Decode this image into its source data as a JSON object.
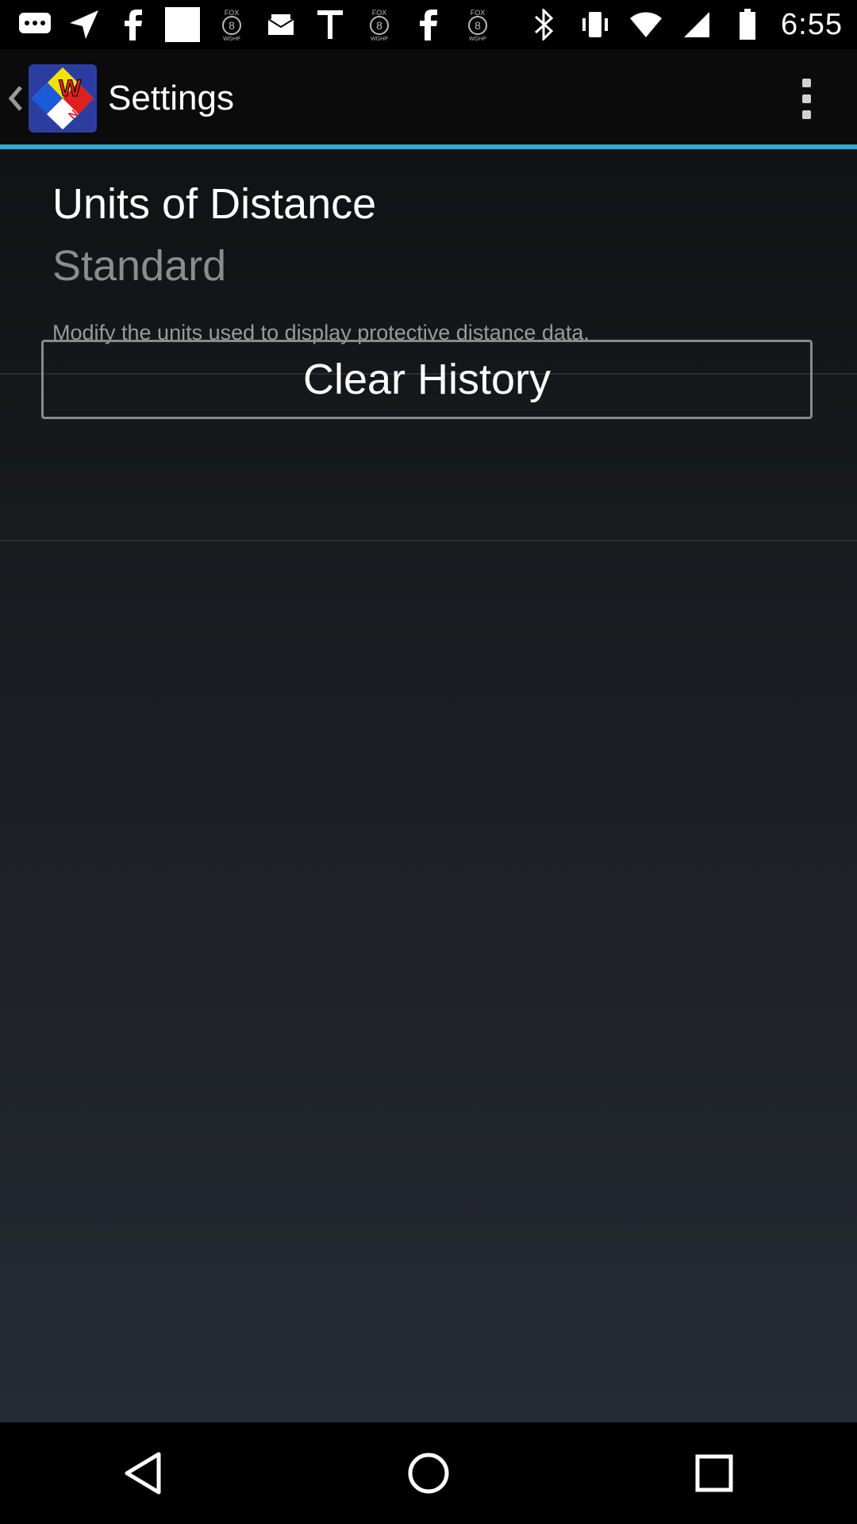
{
  "status_bar": {
    "left_icons": [
      "chat-icon",
      "navigation-icon",
      "facebook-icon",
      "image-icon",
      "fox8-icon",
      "mail-icon",
      "text-t-icon",
      "fox8-icon",
      "facebook-icon",
      "fox8-icon"
    ],
    "fox_label_top": "FOX",
    "fox_label_num": "8",
    "fox_label_bottom": "WGHP",
    "right_icons": [
      "bluetooth-icon",
      "vibrate-icon",
      "wifi-icon",
      "signal-icon",
      "battery-icon"
    ],
    "time": "6:55"
  },
  "action_bar": {
    "title": "Settings",
    "logo_letter": "W",
    "logo_text": "NIH"
  },
  "preference": {
    "title": "Units of Distance",
    "value": "Standard",
    "summary": "Modify the units used to display protective distance data."
  },
  "clear_history": {
    "label": "Clear History"
  },
  "colors": {
    "accent": "#31a8d9",
    "background_top": "#111214",
    "background_bottom": "#262a33"
  }
}
